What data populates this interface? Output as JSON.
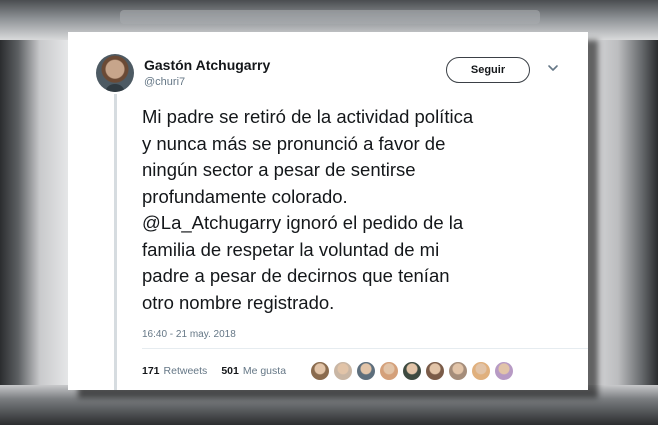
{
  "tweet": {
    "author_name": "Gastón Atchugarry",
    "author_handle": "@churi7",
    "follow_label": "Seguir",
    "text_lines": [
      "Mi padre se retiró de la actividad política",
      "y nunca más se pronunció a favor de",
      "ningún sector a pesar de sentirse",
      "profundamente colorado.",
      "@La_Atchugarry ignoró el pedido de la",
      "familia de respetar la voluntad de mi",
      "padre a pesar de decirnos que tenían",
      "otro nombre registrado."
    ],
    "timestamp": "16:40 - 21 may. 2018",
    "retweets_count": "171",
    "retweets_label": "Retweets",
    "likes_count": "501",
    "likes_label": "Me gusta",
    "liker_avatar_colors": [
      "#8a6b4e",
      "#c9b6a4",
      "#5d6e7c",
      "#d4a07a",
      "#3d4a40",
      "#7a5b48",
      "#a58d7a",
      "#e0b07d",
      "#b79ac4"
    ]
  },
  "icons": {
    "menu": "chevron-down-icon"
  },
  "colors": {
    "text_primary": "#14171a",
    "text_secondary": "#657786",
    "card_bg": "#ffffff"
  }
}
